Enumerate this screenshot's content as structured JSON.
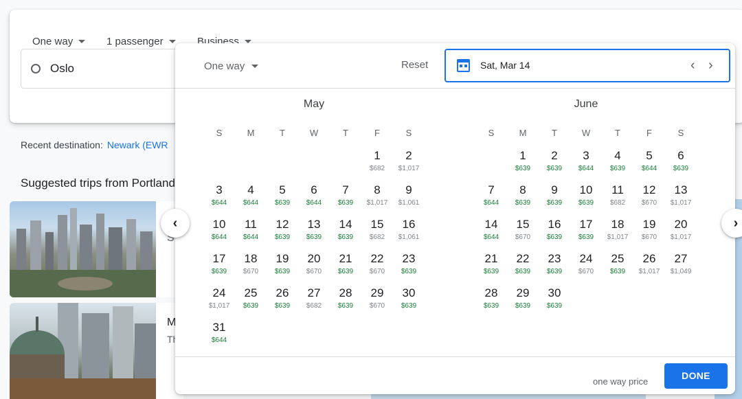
{
  "search": {
    "trip_type": "One way",
    "passengers": "1 passenger",
    "cabin": "Business",
    "origin": "Oslo"
  },
  "recent": {
    "label": "Recent destination:",
    "link": "Newark (EWR"
  },
  "suggested": {
    "title": "Suggested trips from Portland",
    "card1_text": "S",
    "card2_text": "M",
    "card2_sub": "Th"
  },
  "picker": {
    "trip_type": "One way",
    "reset_label": "Reset",
    "selected_date": "Sat, Mar 14",
    "footer_note": "one way price",
    "done_label": "DONE",
    "weekday_labels": [
      "S",
      "M",
      "T",
      "W",
      "T",
      "F",
      "S"
    ],
    "months": [
      {
        "name": "May",
        "first_weekday": 5,
        "days": [
          [
            "1",
            "$682"
          ],
          [
            "2",
            "$1,017"
          ],
          [
            "3",
            "$644"
          ],
          [
            "4",
            "$644"
          ],
          [
            "5",
            "$639"
          ],
          [
            "6",
            "$644"
          ],
          [
            "7",
            "$639"
          ],
          [
            "8",
            "$1,017"
          ],
          [
            "9",
            "$1,061"
          ],
          [
            "10",
            "$644"
          ],
          [
            "11",
            "$644"
          ],
          [
            "12",
            "$639"
          ],
          [
            "13",
            "$639"
          ],
          [
            "14",
            "$639"
          ],
          [
            "15",
            "$682"
          ],
          [
            "16",
            "$1,061"
          ],
          [
            "17",
            "$639"
          ],
          [
            "18",
            "$670"
          ],
          [
            "19",
            "$639"
          ],
          [
            "20",
            "$670"
          ],
          [
            "21",
            "$639"
          ],
          [
            "22",
            "$670"
          ],
          [
            "23",
            "$639"
          ],
          [
            "24",
            "$1,017"
          ],
          [
            "25",
            "$639"
          ],
          [
            "26",
            "$639"
          ],
          [
            "27",
            "$682"
          ],
          [
            "28",
            "$639"
          ],
          [
            "29",
            "$670"
          ],
          [
            "30",
            "$639"
          ],
          [
            "31",
            "$644"
          ]
        ]
      },
      {
        "name": "June",
        "first_weekday": 1,
        "days": [
          [
            "1",
            "$639"
          ],
          [
            "2",
            "$639"
          ],
          [
            "3",
            "$644"
          ],
          [
            "4",
            "$639"
          ],
          [
            "5",
            "$644"
          ],
          [
            "6",
            "$639"
          ],
          [
            "7",
            "$644"
          ],
          [
            "8",
            "$639"
          ],
          [
            "9",
            "$639"
          ],
          [
            "10",
            "$639"
          ],
          [
            "11",
            "$682"
          ],
          [
            "12",
            "$670"
          ],
          [
            "13",
            "$1,017"
          ],
          [
            "14",
            "$644"
          ],
          [
            "15",
            "$670"
          ],
          [
            "16",
            "$639"
          ],
          [
            "17",
            "$639"
          ],
          [
            "18",
            "$1,017"
          ],
          [
            "19",
            "$670"
          ],
          [
            "20",
            "$1,017"
          ],
          [
            "21",
            "$639"
          ],
          [
            "22",
            "$639"
          ],
          [
            "23",
            "$639"
          ],
          [
            "24",
            "$670"
          ],
          [
            "25",
            "$639"
          ],
          [
            "26",
            "$1,017"
          ],
          [
            "27",
            "$1,049"
          ],
          [
            "28",
            "$639"
          ],
          [
            "29",
            "$639"
          ],
          [
            "30",
            "$639"
          ]
        ]
      }
    ],
    "cheap_color": "#188038",
    "expensive_color": "#80868b",
    "accent_color": "#1a73e8"
  }
}
